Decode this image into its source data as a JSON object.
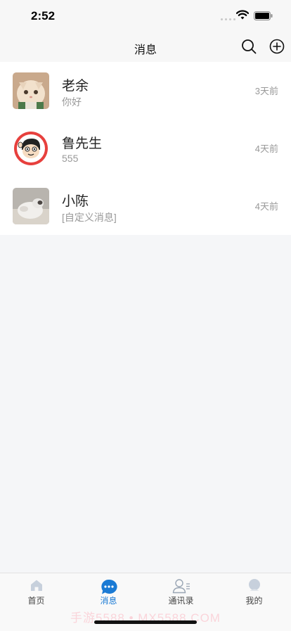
{
  "status_bar": {
    "time": "2:52"
  },
  "nav": {
    "title": "消息"
  },
  "conversations": [
    {
      "name": "老余",
      "preview": "你好",
      "time": "3天前",
      "avatar": "cat-avatar"
    },
    {
      "name": "鲁先生",
      "preview": "555",
      "time": "4天前",
      "avatar": "cartoon-boy-avatar"
    },
    {
      "name": "小陈",
      "preview": "[自定义消息]",
      "time": "4天前",
      "avatar": "pet-photo-avatar"
    }
  ],
  "tabs": [
    {
      "label": "首页",
      "icon": "home-icon",
      "active": false
    },
    {
      "label": "消息",
      "icon": "chat-bubble-icon",
      "active": true
    },
    {
      "label": "通讯录",
      "icon": "contacts-icon",
      "active": false
    },
    {
      "label": "我的",
      "icon": "profile-icon",
      "active": false
    }
  ],
  "watermark": "手游5588 • MX5588.COM",
  "colors": {
    "accent": "#1a7ad4",
    "background": "#f5f6f8",
    "text_muted": "#999999"
  }
}
